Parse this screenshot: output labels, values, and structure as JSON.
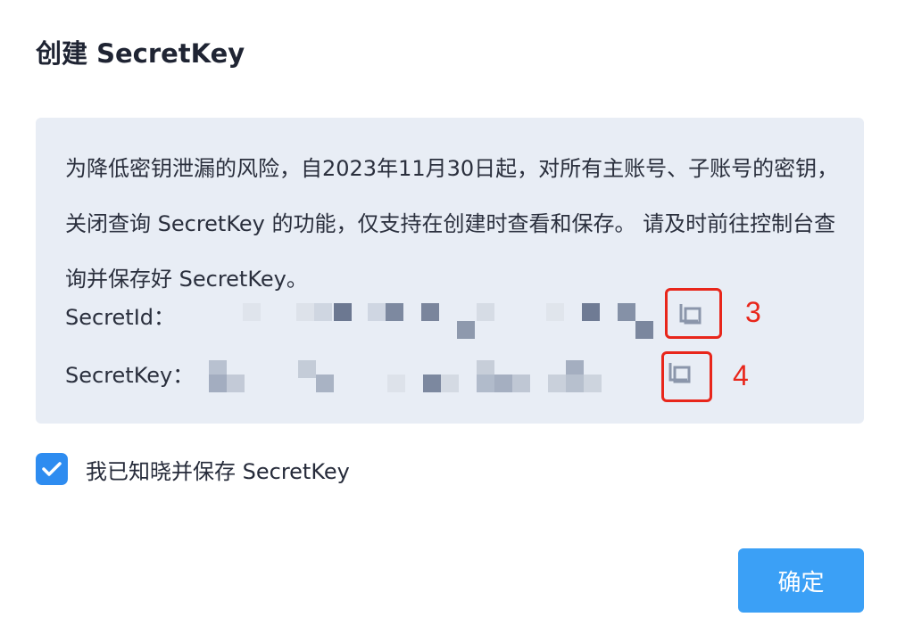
{
  "dialog": {
    "title": "创建 SecretKey",
    "notice_text": "为降低密钥泄漏的风险，自2023年11月30日起，对所有主账号、子账号的密钥，关闭查询 SecretKey 的功能，仅支持在创建时查看和保存。 请及时前往控制台查询并保存好 SecretKey。",
    "secret_id": {
      "label": "SecretId：",
      "copy_icon": "copy-icon",
      "annotation": "3"
    },
    "secret_key": {
      "label": "SecretKey：",
      "copy_icon": "copy-icon",
      "annotation": "4"
    },
    "acknowledge": {
      "checked": true,
      "label": "我已知晓并保存 SecretKey"
    },
    "confirm_label": "确定"
  },
  "colors": {
    "accent": "#3ba0f6",
    "checkbox": "#2e8cf0",
    "notice_bg": "#e8edf5",
    "annotation": "#e8261b",
    "icon": "#8b96ab"
  }
}
